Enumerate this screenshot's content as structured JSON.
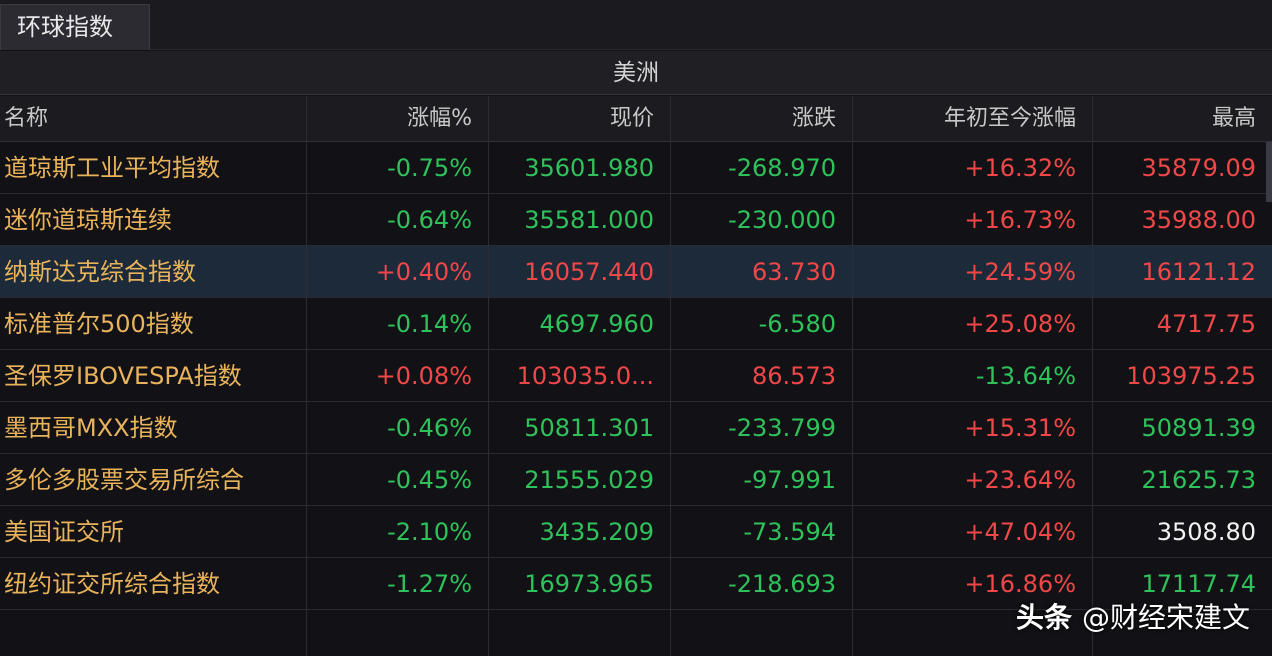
{
  "tab": {
    "label": "环球指数"
  },
  "region": {
    "label": "美洲"
  },
  "columns": [
    "名称",
    "涨幅%",
    "现价",
    "涨跌",
    "年初至今涨幅",
    "最高"
  ],
  "rows": [
    {
      "name": "道琼斯工业平均指数",
      "change_pct": "-0.75%",
      "price": "35601.980",
      "change": "-268.970",
      "ytd": "+16.32%",
      "high": "35879.09"
    },
    {
      "name": "迷你道琼斯连续",
      "change_pct": "-0.64%",
      "price": "35581.000",
      "change": "-230.000",
      "ytd": "+16.73%",
      "high": "35988.00"
    },
    {
      "name": "纳斯达克综合指数",
      "change_pct": "+0.40%",
      "price": "16057.440",
      "change": "63.730",
      "ytd": "+24.59%",
      "high": "16121.12"
    },
    {
      "name": "标准普尔500指数",
      "change_pct": "-0.14%",
      "price": "4697.960",
      "change": "-6.580",
      "ytd": "+25.08%",
      "high": "4717.75"
    },
    {
      "name": "圣保罗IBOVESPA指数",
      "change_pct": "+0.08%",
      "price": "103035.0...",
      "change": "86.573",
      "ytd": "-13.64%",
      "high": "103975.25"
    },
    {
      "name": "墨西哥MXX指数",
      "change_pct": "-0.46%",
      "price": "50811.301",
      "change": "-233.799",
      "ytd": "+15.31%",
      "high": "50891.39"
    },
    {
      "name": "多伦多股票交易所综合",
      "change_pct": "-0.45%",
      "price": "21555.029",
      "change": "-97.991",
      "ytd": "+23.64%",
      "high": "21625.73"
    },
    {
      "name": "美国证交所",
      "change_pct": "-2.10%",
      "price": "3435.209",
      "change": "-73.594",
      "ytd": "+47.04%",
      "high": "3508.80"
    },
    {
      "name": "纽约证交所综合指数",
      "change_pct": "-1.27%",
      "price": "16973.965",
      "change": "-218.693",
      "ytd": "+16.86%",
      "high": "17117.74"
    }
  ],
  "colors": {
    "up": "#f04848",
    "down": "#2fc25b",
    "neutral": "#f2f2f2",
    "name": "#e8b35a",
    "selected_row": "#1c2a3a"
  },
  "watermark": {
    "brand": "头条",
    "handle": "@财经宋建文"
  }
}
